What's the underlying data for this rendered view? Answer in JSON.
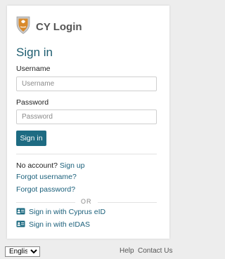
{
  "brand": {
    "title": "CY Login",
    "logo_icon": "cyprus-coat-of-arms-icon"
  },
  "page": {
    "heading": "Sign in"
  },
  "form": {
    "username_label": "Username",
    "username_placeholder": "Username",
    "username_value": "",
    "password_label": "Password",
    "password_placeholder": "Password",
    "password_value": "",
    "submit_label": "Sign in"
  },
  "links": {
    "no_account_text": "No account?",
    "sign_up": "Sign up",
    "forgot_username": "Forgot username?",
    "forgot_password": "Forgot password?"
  },
  "alternatives": {
    "separator": "OR",
    "cyprus_eid": "Sign in with Cyprus eID",
    "eidas": "Sign in with eIDAS",
    "icon": "id-card-icon"
  },
  "footer": {
    "language_selected": "English",
    "help": "Help",
    "contact": "Contact Us"
  },
  "colors": {
    "accent": "#1e6b82",
    "heading": "#1e5d70",
    "link": "#1a5f7a"
  }
}
